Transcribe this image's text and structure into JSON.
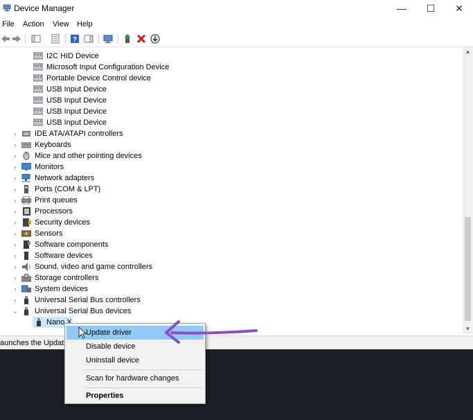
{
  "window": {
    "title": "Device Manager",
    "controls": {
      "minimize": "—",
      "maximize": "☐",
      "close": "✕"
    }
  },
  "menubar": [
    "File",
    "Action",
    "View",
    "Help"
  ],
  "tree": {
    "child_items": [
      "I2C HID Device",
      "Microsoft Input Configuration Device",
      "Portable Device Control device",
      "USB Input Device",
      "USB Input Device",
      "USB Input Device",
      "USB Input Device"
    ],
    "categories": [
      {
        "label": "IDE ATA/ATAPI controllers",
        "icon": "ide-controller-icon"
      },
      {
        "label": "Keyboards",
        "icon": "keyboard-icon"
      },
      {
        "label": "Mice and other pointing devices",
        "icon": "mouse-icon"
      },
      {
        "label": "Monitors",
        "icon": "monitor-icon"
      },
      {
        "label": "Network adapters",
        "icon": "network-adapter-icon"
      },
      {
        "label": "Ports (COM & LPT)",
        "icon": "port-icon"
      },
      {
        "label": "Print queues",
        "icon": "printer-icon"
      },
      {
        "label": "Processors",
        "icon": "processor-icon"
      },
      {
        "label": "Security devices",
        "icon": "security-device-icon"
      },
      {
        "label": "Sensors",
        "icon": "sensor-icon"
      },
      {
        "label": "Software components",
        "icon": "software-component-icon"
      },
      {
        "label": "Software devices",
        "icon": "software-device-icon"
      },
      {
        "label": "Sound, video and game controllers",
        "icon": "speaker-icon"
      },
      {
        "label": "Storage controllers",
        "icon": "storage-controller-icon"
      },
      {
        "label": "System devices",
        "icon": "system-device-icon"
      },
      {
        "label": "Universal Serial Bus controllers",
        "icon": "usb-icon"
      },
      {
        "label": "Universal Serial Bus devices",
        "icon": "usb-icon",
        "expanded": true
      }
    ],
    "selected_device": "Nano X"
  },
  "status_bar": {
    "text": "aunches the Update"
  },
  "context_menu": {
    "items": [
      "Update driver",
      "Disable device",
      "Uninstall device",
      "Scan for hardware changes",
      "Properties"
    ],
    "hovered": "Update driver",
    "default_item": "Properties"
  },
  "colors": {
    "selection": "#cce8ff",
    "menu_hover": "#91c9f7",
    "annotation_arrow": "#8a4fc7",
    "taskbar": "#1b1f26"
  }
}
